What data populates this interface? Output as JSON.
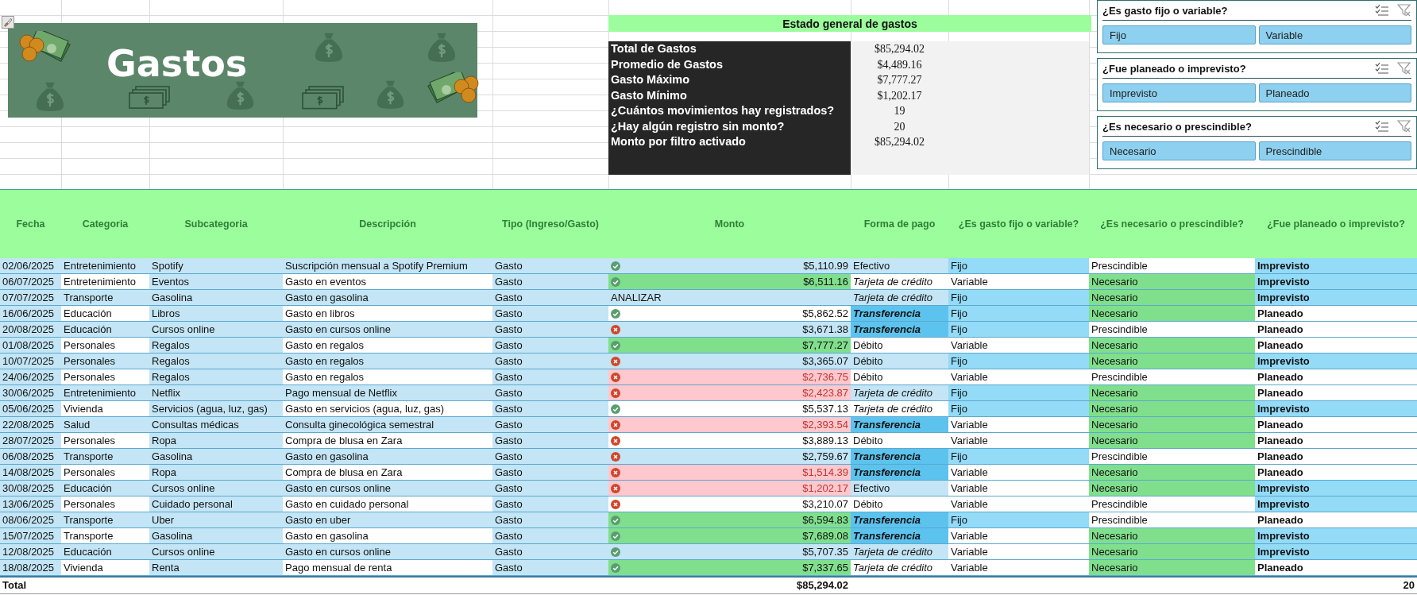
{
  "title_banner": {
    "title": "Gastos"
  },
  "summary": {
    "title": "Estado general de gastos",
    "rows": [
      {
        "label": "Total de Gastos",
        "value": "$85,294.02"
      },
      {
        "label": "Promedio de Gastos",
        "value": "$4,489.16"
      },
      {
        "label": "Gasto Máximo",
        "value": "$7,777.27"
      },
      {
        "label": "Gasto Mínimo",
        "value": "$1,202.17"
      },
      {
        "label": "¿Cuántos movimientos hay registrados?",
        "value": "19"
      },
      {
        "label": "¿Hay algún registro sin monto?",
        "value": "20"
      },
      {
        "label": "Monto por filtro activado",
        "value": "$85,294.02"
      }
    ]
  },
  "slicers": [
    {
      "title": "¿Es gasto fijo o variable?",
      "options": [
        {
          "label": "Fijo",
          "selected": true
        },
        {
          "label": "Variable",
          "selected": true
        }
      ]
    },
    {
      "title": "¿Fue planeado o imprevisto?",
      "options": [
        {
          "label": "Imprevisto",
          "selected": true
        },
        {
          "label": "Planeado",
          "selected": true
        }
      ]
    },
    {
      "title": "¿Es necesario o prescindible?",
      "options": [
        {
          "label": "Necesario",
          "selected": true
        },
        {
          "label": "Prescindible",
          "selected": true
        }
      ]
    }
  ],
  "table": {
    "columns": [
      "Fecha",
      "Categoria",
      "Subcategoria",
      "Descripción",
      "Tipo (Ingreso/Gasto)",
      "Monto",
      "Forma de pago",
      "¿Es gasto fijo o variable?",
      "¿Es necesario o prescindible?",
      "¿Fue planeado o imprevisto?"
    ],
    "rows": [
      {
        "fecha": "02/06/2025",
        "categoria": "Entretenimiento",
        "subcategoria": "Spotify",
        "descripcion": "Suscripción mensual a Spotify Premium",
        "tipo": "Gasto",
        "kind": "ok",
        "monto": "$5,110.99",
        "monto_above_range": false,
        "monto_below_range": false,
        "forma": "Efectivo",
        "forma_italic": false,
        "forma_bold": false,
        "fijo": "Fijo",
        "fijo_highlighted": true,
        "necesidad": "Prescindible",
        "necesidad_highlighted": false,
        "planeacion": "Imprevisto",
        "planeacion_highlighted": true
      },
      {
        "fecha": "06/07/2025",
        "categoria": "Entretenimiento",
        "subcategoria": "Eventos",
        "descripcion": "Gasto en eventos",
        "tipo": "Gasto",
        "kind": "ok",
        "monto": "$6,511.16",
        "monto_above_range": true,
        "monto_below_range": false,
        "forma": "Tarjeta de crédito",
        "forma_italic": true,
        "forma_bold": false,
        "fijo": "Variable",
        "fijo_highlighted": false,
        "necesidad": "Necesario",
        "necesidad_highlighted": true,
        "planeacion": "Imprevisto",
        "planeacion_highlighted": true
      },
      {
        "fecha": "07/07/2025",
        "categoria": "Transporte",
        "subcategoria": "Gasolina",
        "descripcion": "Gasto en gasolina",
        "tipo": "Gasto",
        "kind": "review",
        "flag": "ANALIZAR",
        "monto_above_range": false,
        "monto_below_range": false,
        "forma": "Tarjeta de crédito",
        "forma_italic": true,
        "forma_bold": false,
        "fijo": "Fijo",
        "fijo_highlighted": true,
        "necesidad": "Necesario",
        "necesidad_highlighted": true,
        "planeacion": "Imprevisto",
        "planeacion_highlighted": true
      },
      {
        "fecha": "16/06/2025",
        "categoria": "Educación",
        "subcategoria": "Libros",
        "descripcion": "Gasto en libros",
        "tipo": "Gasto",
        "kind": "ok",
        "monto": "$5,862.52",
        "monto_above_range": false,
        "monto_below_range": false,
        "forma": "Transferencia",
        "forma_italic": true,
        "forma_bold": true,
        "fijo": "Fijo",
        "fijo_highlighted": true,
        "necesidad": "Necesario",
        "necesidad_highlighted": true,
        "planeacion": "Planeado",
        "planeacion_highlighted": false
      },
      {
        "fecha": "20/08/2025",
        "categoria": "Educación",
        "subcategoria": "Cursos online",
        "descripcion": "Gasto en cursos online",
        "tipo": "Gasto",
        "kind": "bad",
        "monto": "$3,671.38",
        "monto_above_range": false,
        "monto_below_range": false,
        "forma": "Transferencia",
        "forma_italic": true,
        "forma_bold": true,
        "fijo": "Fijo",
        "fijo_highlighted": true,
        "necesidad": "Prescindible",
        "necesidad_highlighted": false,
        "planeacion": "Planeado",
        "planeacion_highlighted": false
      },
      {
        "fecha": "01/08/2025",
        "categoria": "Personales",
        "subcategoria": "Regalos",
        "descripcion": "Gasto en regalos",
        "tipo": "Gasto",
        "kind": "ok",
        "monto": "$7,777.27",
        "monto_above_range": true,
        "monto_below_range": false,
        "forma": "Débito",
        "forma_italic": false,
        "forma_bold": false,
        "fijo": "Variable",
        "fijo_highlighted": false,
        "necesidad": "Necesario",
        "necesidad_highlighted": true,
        "planeacion": "Planeado",
        "planeacion_highlighted": false
      },
      {
        "fecha": "10/07/2025",
        "categoria": "Personales",
        "subcategoria": "Regalos",
        "descripcion": "Gasto en regalos",
        "tipo": "Gasto",
        "kind": "bad",
        "monto": "$3,365.07",
        "monto_above_range": false,
        "monto_below_range": false,
        "forma": "Débito",
        "forma_italic": false,
        "forma_bold": false,
        "fijo": "Fijo",
        "fijo_highlighted": true,
        "necesidad": "Necesario",
        "necesidad_highlighted": true,
        "planeacion": "Imprevisto",
        "planeacion_highlighted": true
      },
      {
        "fecha": "24/06/2025",
        "categoria": "Personales",
        "subcategoria": "Regalos",
        "descripcion": "Gasto en regalos",
        "tipo": "Gasto",
        "kind": "bad",
        "monto": "$2,736.75",
        "monto_above_range": false,
        "monto_below_range": true,
        "forma": "Débito",
        "forma_italic": false,
        "forma_bold": false,
        "fijo": "Variable",
        "fijo_highlighted": false,
        "necesidad": "Prescindible",
        "necesidad_highlighted": false,
        "planeacion": "Planeado",
        "planeacion_highlighted": false
      },
      {
        "fecha": "30/06/2025",
        "categoria": "Entretenimiento",
        "subcategoria": "Netflix",
        "descripcion": "Pago mensual de Netflix",
        "tipo": "Gasto",
        "kind": "bad",
        "monto": "$2,423.87",
        "monto_above_range": false,
        "monto_below_range": true,
        "forma": "Tarjeta de crédito",
        "forma_italic": true,
        "forma_bold": false,
        "fijo": "Fijo",
        "fijo_highlighted": true,
        "necesidad": "Necesario",
        "necesidad_highlighted": true,
        "planeacion": "Planeado",
        "planeacion_highlighted": false
      },
      {
        "fecha": "05/06/2025",
        "categoria": "Vivienda",
        "subcategoria": "Servicios (agua, luz, gas)",
        "descripcion": "Gasto en servicios (agua, luz, gas)",
        "tipo": "Gasto",
        "kind": "ok",
        "monto": "$5,537.13",
        "monto_above_range": false,
        "monto_below_range": false,
        "forma": "Tarjeta de crédito",
        "forma_italic": true,
        "forma_bold": false,
        "fijo": "Fijo",
        "fijo_highlighted": true,
        "necesidad": "Necesario",
        "necesidad_highlighted": true,
        "planeacion": "Imprevisto",
        "planeacion_highlighted": true
      },
      {
        "fecha": "22/08/2025",
        "categoria": "Salud",
        "subcategoria": "Consultas médicas",
        "descripcion": "Consulta ginecológica semestral",
        "tipo": "Gasto",
        "kind": "bad",
        "monto": "$2,393.54",
        "monto_above_range": false,
        "monto_below_range": true,
        "forma": "Transferencia",
        "forma_italic": true,
        "forma_bold": true,
        "fijo": "Variable",
        "fijo_highlighted": false,
        "necesidad": "Necesario",
        "necesidad_highlighted": true,
        "planeacion": "Planeado",
        "planeacion_highlighted": false
      },
      {
        "fecha": "28/07/2025",
        "categoria": "Personales",
        "subcategoria": "Ropa",
        "descripcion": "Compra de blusa en Zara",
        "tipo": "Gasto",
        "kind": "bad",
        "monto": "$3,889.13",
        "monto_above_range": false,
        "monto_below_range": false,
        "forma": "Débito",
        "forma_italic": false,
        "forma_bold": false,
        "fijo": "Variable",
        "fijo_highlighted": false,
        "necesidad": "Necesario",
        "necesidad_highlighted": true,
        "planeacion": "Planeado",
        "planeacion_highlighted": false
      },
      {
        "fecha": "06/08/2025",
        "categoria": "Transporte",
        "subcategoria": "Gasolina",
        "descripcion": "Gasto en gasolina",
        "tipo": "Gasto",
        "kind": "bad",
        "monto": "$2,759.67",
        "monto_above_range": false,
        "monto_below_range": false,
        "forma": "Transferencia",
        "forma_italic": true,
        "forma_bold": true,
        "fijo": "Fijo",
        "fijo_highlighted": true,
        "necesidad": "Prescindible",
        "necesidad_highlighted": false,
        "planeacion": "Planeado",
        "planeacion_highlighted": false
      },
      {
        "fecha": "14/08/2025",
        "categoria": "Personales",
        "subcategoria": "Ropa",
        "descripcion": "Compra de blusa en Zara",
        "tipo": "Gasto",
        "kind": "bad",
        "monto": "$1,514.39",
        "monto_above_range": false,
        "monto_below_range": true,
        "forma": "Transferencia",
        "forma_italic": true,
        "forma_bold": true,
        "fijo": "Variable",
        "fijo_highlighted": false,
        "necesidad": "Necesario",
        "necesidad_highlighted": true,
        "planeacion": "Planeado",
        "planeacion_highlighted": false
      },
      {
        "fecha": "30/08/2025",
        "categoria": "Educación",
        "subcategoria": "Cursos online",
        "descripcion": "Gasto en cursos online",
        "tipo": "Gasto",
        "kind": "bad",
        "monto": "$1,202.17",
        "monto_above_range": false,
        "monto_below_range": true,
        "forma": "Efectivo",
        "forma_italic": false,
        "forma_bold": false,
        "fijo": "Variable",
        "fijo_highlighted": false,
        "necesidad": "Necesario",
        "necesidad_highlighted": true,
        "planeacion": "Imprevisto",
        "planeacion_highlighted": true
      },
      {
        "fecha": "13/06/2025",
        "categoria": "Personales",
        "subcategoria": "Cuidado personal",
        "descripcion": "Gasto en cuidado personal",
        "tipo": "Gasto",
        "kind": "bad",
        "monto": "$3,210.07",
        "monto_above_range": false,
        "monto_below_range": false,
        "forma": "Débito",
        "forma_italic": false,
        "forma_bold": false,
        "fijo": "Variable",
        "fijo_highlighted": false,
        "necesidad": "Prescindible",
        "necesidad_highlighted": false,
        "planeacion": "Imprevisto",
        "planeacion_highlighted": true
      },
      {
        "fecha": "08/06/2025",
        "categoria": "Transporte",
        "subcategoria": "Uber",
        "descripcion": "Gasto en uber",
        "tipo": "Gasto",
        "kind": "ok",
        "monto": "$6,594.83",
        "monto_above_range": true,
        "monto_below_range": false,
        "forma": "Transferencia",
        "forma_italic": true,
        "forma_bold": true,
        "fijo": "Fijo",
        "fijo_highlighted": true,
        "necesidad": "Prescindible",
        "necesidad_highlighted": false,
        "planeacion": "Planeado",
        "planeacion_highlighted": false
      },
      {
        "fecha": "15/07/2025",
        "categoria": "Transporte",
        "subcategoria": "Gasolina",
        "descripcion": "Gasto en gasolina",
        "tipo": "Gasto",
        "kind": "ok",
        "monto": "$7,689.08",
        "monto_above_range": true,
        "monto_below_range": false,
        "forma": "Transferencia",
        "forma_italic": true,
        "forma_bold": true,
        "fijo": "Variable",
        "fijo_highlighted": false,
        "necesidad": "Necesario",
        "necesidad_highlighted": true,
        "planeacion": "Imprevisto",
        "planeacion_highlighted": true
      },
      {
        "fecha": "12/08/2025",
        "categoria": "Educación",
        "subcategoria": "Cursos online",
        "descripcion": "Gasto en cursos online",
        "tipo": "Gasto",
        "kind": "ok",
        "monto": "$5,707.35",
        "monto_above_range": false,
        "monto_below_range": false,
        "forma": "Tarjeta de crédito",
        "forma_italic": true,
        "forma_bold": false,
        "fijo": "Variable",
        "fijo_highlighted": false,
        "necesidad": "Necesario",
        "necesidad_highlighted": true,
        "planeacion": "Imprevisto",
        "planeacion_highlighted": true
      },
      {
        "fecha": "18/08/2025",
        "categoria": "Vivienda",
        "subcategoria": "Renta",
        "descripcion": "Pago mensual de renta",
        "tipo": "Gasto",
        "kind": "ok",
        "monto": "$7,337.65",
        "monto_above_range": true,
        "monto_below_range": false,
        "forma": "Tarjeta de crédito",
        "forma_italic": true,
        "forma_bold": false,
        "fijo": "Variable",
        "fijo_highlighted": false,
        "necesidad": "Necesario",
        "necesidad_highlighted": true,
        "planeacion": "Planeado",
        "planeacion_highlighted": false
      }
    ],
    "total": {
      "label": "Total",
      "amount": "$85,294.02",
      "count": "20"
    }
  }
}
